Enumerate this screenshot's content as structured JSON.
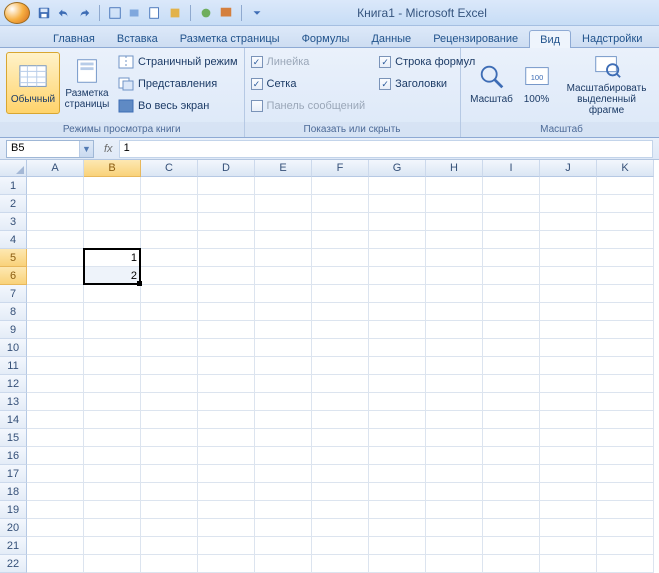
{
  "title": "Книга1 - Microsoft Excel",
  "tabs": [
    "Главная",
    "Вставка",
    "Разметка страницы",
    "Формулы",
    "Данные",
    "Рецензирование",
    "Вид",
    "Надстройки"
  ],
  "active_tab": "Вид",
  "ribbon": {
    "group1": {
      "label": "Режимы просмотра книги",
      "normal": "Обычный",
      "page_layout": "Разметка страницы",
      "page_break": "Страничный режим",
      "custom_views": "Представления",
      "full_screen": "Во весь экран"
    },
    "group2": {
      "label": "Показать или скрыть",
      "ruler": "Линейка",
      "gridlines": "Сетка",
      "messages": "Панель сообщений",
      "formula_bar": "Строка формул",
      "headings": "Заголовки"
    },
    "group3": {
      "label": "Масштаб",
      "zoom": "Масштаб",
      "zoom100": "100%",
      "zoom_selection_l1": "Масштабировать",
      "zoom_selection_l2": "выделенный фрагме"
    }
  },
  "namebox": "B5",
  "formula": "1",
  "columns": [
    "A",
    "B",
    "C",
    "D",
    "E",
    "F",
    "G",
    "H",
    "I",
    "J",
    "K"
  ],
  "rows": [
    "1",
    "2",
    "3",
    "4",
    "5",
    "6",
    "7",
    "8",
    "9",
    "10",
    "11",
    "12",
    "13",
    "14",
    "15",
    "16",
    "17",
    "18",
    "19",
    "20",
    "21",
    "22"
  ],
  "cells": {
    "B5": "1",
    "B6": "2"
  },
  "selection": {
    "col": "B",
    "rows": [
      "5",
      "6"
    ]
  }
}
